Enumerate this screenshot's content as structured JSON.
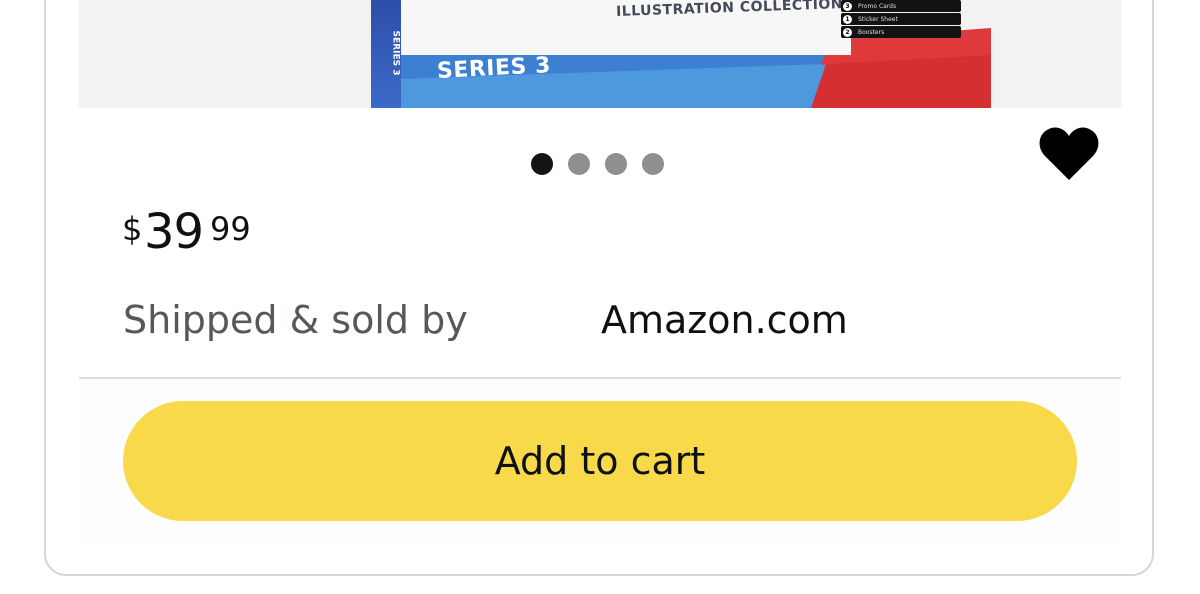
{
  "product_image": {
    "collection_text": "ILLUSTRATION COLLECTION",
    "series_text": "SERIES 3",
    "spine_text": "SERIES 3",
    "contents": [
      {
        "num": "3",
        "label": "Promo Cards"
      },
      {
        "num": "1",
        "label": "Sticker Sheet"
      },
      {
        "num": "2",
        "label": "Boosters"
      }
    ]
  },
  "carousel": {
    "count": 4,
    "active_index": 0
  },
  "favorite": {
    "icon": "heart-icon",
    "color": "#000000"
  },
  "price": {
    "symbol": "$",
    "whole": "39",
    "fraction": "99"
  },
  "shipping": {
    "label": "Shipped & sold by",
    "seller": "Amazon.com"
  },
  "cart": {
    "button_label": "Add to cart",
    "button_color": "#f8d94a"
  }
}
